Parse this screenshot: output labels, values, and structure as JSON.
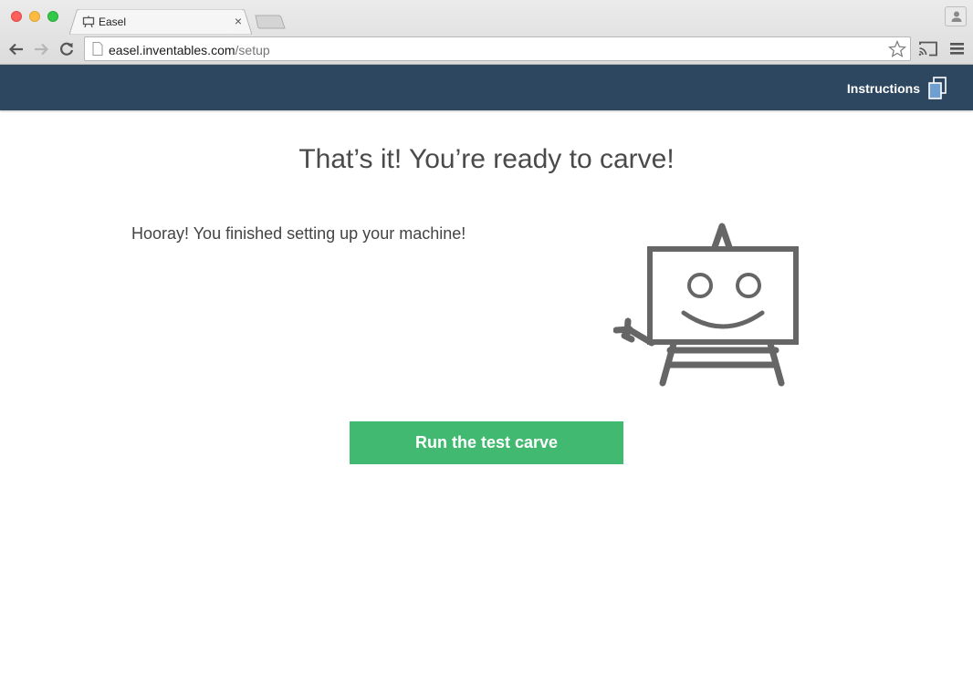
{
  "browser": {
    "tab_title": "Easel",
    "tab_close_glyph": "×",
    "url_host": "easel.inventables.com",
    "url_path": "/setup",
    "icons": {
      "back": "arrow-left-icon",
      "forward": "arrow-right-icon",
      "reload": "reload-icon",
      "bookmark": "star-icon",
      "cast": "cast-icon",
      "menu": "hamburger-menu-icon",
      "profile": "user-icon",
      "page": "page-icon"
    }
  },
  "header": {
    "background_color": "#2e4760",
    "instructions_label": "Instructions",
    "instructions_icon": "documents-icon"
  },
  "main": {
    "heading": "That’s it! You’re ready to carve!",
    "message": "Hooray! You finished setting up your machine!",
    "mascot_icon": "easel-mascot-icon",
    "cta_label": "Run the test carve",
    "cta_color": "#41b970"
  }
}
